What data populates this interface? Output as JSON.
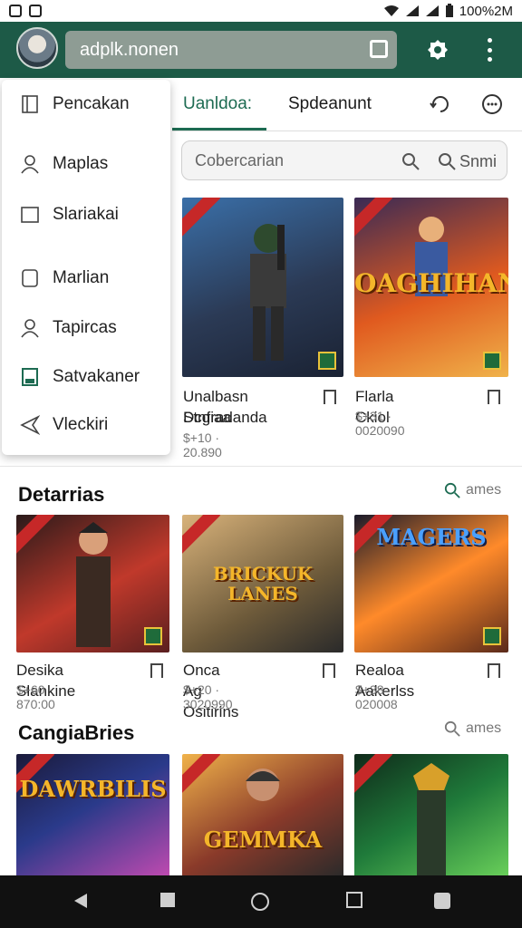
{
  "status": {
    "time": "100%2M"
  },
  "topbar": {
    "title": "adplk.nonen"
  },
  "menu": {
    "items": [
      "Pencakan",
      "Maplas",
      "Slariakai",
      "Marlian",
      "Tapircas",
      "Satvakaner",
      "Vleckiri"
    ]
  },
  "tabs": [
    "Uanldoa:",
    "Spdeanunt"
  ],
  "search": {
    "placeholder": "Cobercarian",
    "right_label": "Snmi"
  },
  "featured": [
    {
      "title": "Unalbasn Stnfiaa",
      "subtitle": "Dcgradanda",
      "price": "$+10 · 20.890",
      "colors": [
        "#2b3a55",
        "#3a6fa8",
        "#1a2233"
      ]
    },
    {
      "title": "Flarla Ckiol",
      "subtitle": "",
      "price": "$+31 · 0020090",
      "colors": [
        "#e05a1f",
        "#f0b24a",
        "#3a2a55"
      ],
      "overlay": "OAGHIHAN"
    }
  ],
  "sections": [
    {
      "title": "Detarrias",
      "link": "ames",
      "cards": [
        {
          "title": "Desika Slankine",
          "price": "$+60 · 870:00",
          "colors": [
            "#5a1f1f",
            "#c0392b",
            "#2b1a1a"
          ]
        },
        {
          "title": "Onca Ag Ositirins",
          "price": "$+20 · 3020990",
          "colors": [
            "#d8b27a",
            "#6d5a3a",
            "#2a2a2a"
          ],
          "overlay": "BRICKUK LANES"
        },
        {
          "title": "Realoa Aakerlss",
          "price": "$+38 · 020008",
          "colors": [
            "#ff8a2a",
            "#5a2a1a",
            "#1a1a2a"
          ],
          "overlay": "MAGERS"
        }
      ]
    },
    {
      "title": "CangiaBries",
      "link": "ames",
      "cards": [
        {
          "colors": [
            "#2a3a8a",
            "#c04ab0",
            "#1a1a3a"
          ],
          "overlay": "DAWRBILIS"
        },
        {
          "colors": [
            "#f0b24a",
            "#8a3a2a",
            "#2a2a2a"
          ],
          "overlay": "GEMMKA"
        },
        {
          "colors": [
            "#1f7a3a",
            "#6ad05a",
            "#0f2a1a"
          ]
        }
      ]
    }
  ]
}
